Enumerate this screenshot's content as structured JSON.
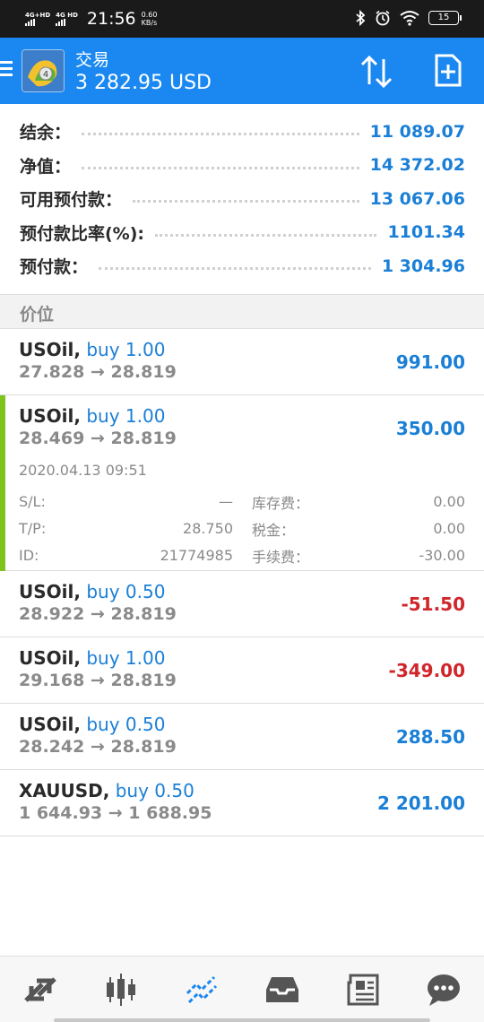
{
  "status_bar": {
    "net1": "4G+HD",
    "net2": "4G HD",
    "time": "21:56",
    "speed_value": "0.60",
    "speed_unit": "KB/s",
    "battery": "15"
  },
  "header": {
    "title": "交易",
    "balance": "3 282.95 USD",
    "accent": "#1a88f0"
  },
  "summary": [
    {
      "label": "结余：",
      "value": "11 089.07"
    },
    {
      "label": "净值：",
      "value": "14 372.02"
    },
    {
      "label": "可用预付款：",
      "value": "13 067.06"
    },
    {
      "label": "预付款比率(%):",
      "value": "1101.34"
    },
    {
      "label": "预付款：",
      "value": "1 304.96"
    }
  ],
  "section_title": "价位",
  "positions": [
    {
      "symbol": "USOil,",
      "type": "buy 1.00",
      "prices": "27.828 → 28.819",
      "profit": "991.00",
      "sign": "positive"
    },
    {
      "symbol": "USOil,",
      "type": "buy 1.00",
      "prices": "28.469 → 28.819",
      "profit": "350.00",
      "sign": "positive",
      "details": {
        "date": "2020.04.13 09:51",
        "sl_label": "S/L:",
        "sl_value": "—",
        "swap_label": "库存费：",
        "swap_value": "0.00",
        "tp_label": "T/P:",
        "tp_value": "28.750",
        "tax_label": "税金：",
        "tax_value": "0.00",
        "id_label": "ID:",
        "id_value": "21774985",
        "fee_label": "手续费：",
        "fee_value": "-30.00"
      }
    },
    {
      "symbol": "USOil,",
      "type": "buy 0.50",
      "prices": "28.922 → 28.819",
      "profit": "-51.50",
      "sign": "negative"
    },
    {
      "symbol": "USOil,",
      "type": "buy 1.00",
      "prices": "29.168 → 28.819",
      "profit": "-349.00",
      "sign": "negative"
    },
    {
      "symbol": "USOil,",
      "type": "buy 0.50",
      "prices": "28.242 → 28.819",
      "profit": "288.50",
      "sign": "positive"
    },
    {
      "symbol": "XAUUSD,",
      "type": "buy 0.50",
      "prices": "1 644.93 → 1 688.95",
      "profit": "2 201.00",
      "sign": "positive"
    }
  ],
  "bottom_nav": [
    {
      "icon": "quotes-icon",
      "active": false
    },
    {
      "icon": "chart-candles-icon",
      "active": false
    },
    {
      "icon": "trade-icon",
      "active": true
    },
    {
      "icon": "history-inbox-icon",
      "active": false
    },
    {
      "icon": "news-icon",
      "active": false
    },
    {
      "icon": "chat-icon",
      "active": false
    }
  ]
}
